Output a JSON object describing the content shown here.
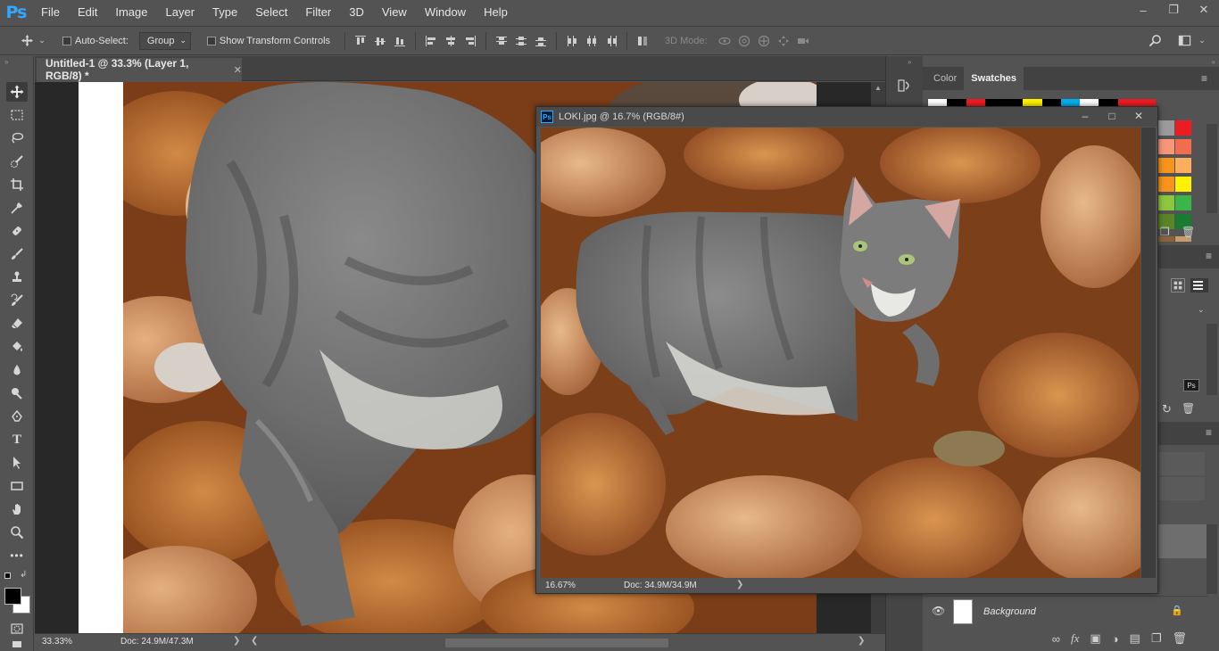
{
  "app": {
    "logo": "Ps",
    "menu": [
      "File",
      "Edit",
      "Image",
      "Layer",
      "Type",
      "Select",
      "Filter",
      "3D",
      "View",
      "Window",
      "Help"
    ]
  },
  "options_bar": {
    "auto_select_label": "Auto-Select:",
    "auto_select_value": "Group",
    "transform_label": "Show Transform Controls",
    "mode_3d_label": "3D Mode:"
  },
  "main_document": {
    "tab_title": "Untitled-1 @ 33.3% (Layer 1, RGB/8) *",
    "zoom": "33.33%",
    "doc_info": "Doc: 24.9M/47.3M"
  },
  "floating_document": {
    "title": "LOKI.jpg @ 16.7% (RGB/8#)",
    "zoom": "16.67%",
    "doc_info": "Doc: 34.9M/34.9M"
  },
  "panels": {
    "tabs": [
      "Color",
      "Swatches"
    ],
    "active_tab": "Swatches",
    "layer_name": "Background",
    "swatches_visible": [
      "#ffffff",
      "#000000",
      "#ed1c24",
      "#000000",
      "#000000",
      "#fff200",
      "#000000",
      "#00aeef",
      "#ffffff",
      "#000000",
      "#ed1c24",
      "#ed1c24"
    ],
    "swatch_grid": [
      "#9a9a9a",
      "#ed1c24",
      "#f7977a",
      "#f26c4f",
      "#f7941d",
      "#fbaf5d",
      "#f7941d",
      "#fff200",
      "#8dc63f",
      "#c4df9b",
      "#39b54a",
      "#197b30",
      "#8c6239",
      "#c69c6d"
    ]
  },
  "colors": {
    "accent": "#31a8ff",
    "chrome": "#535353",
    "dark": "#282828"
  }
}
